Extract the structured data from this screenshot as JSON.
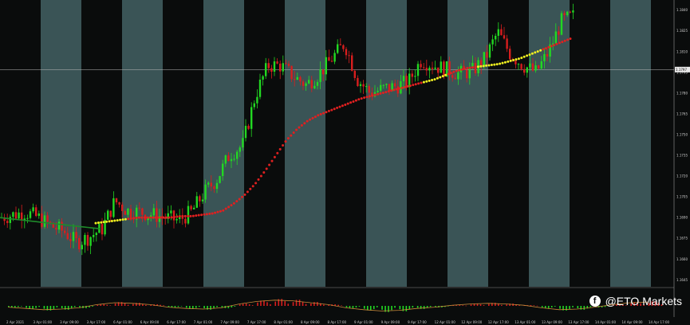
{
  "colors": {
    "background": "#0a0c0c",
    "band": "#3a5456",
    "bull": "#22d822",
    "bear": "#d81e1e",
    "ma_red": "#e02020",
    "ma_yellow": "#f0f020",
    "ma_green": "#1e8a2a",
    "axis_text": "#d0d0d0",
    "watermark": "#ffffff"
  },
  "watermark": {
    "icon": "facebook-icon",
    "text": "@ETO Markets"
  },
  "chart_data": {
    "type": "candlestick",
    "title": "",
    "xlabel": "",
    "ylabel": "",
    "ylim": [
      1.164,
      1.1845
    ],
    "current_price_label": "1.1797",
    "yticks": [
      "1.1840",
      "1.1825",
      "1.1810",
      "1.1795",
      "1.1780",
      "1.1765",
      "1.1750",
      "1.1735",
      "1.1720",
      "1.1705",
      "1.1690",
      "1.1675",
      "1.1660",
      "1.1645"
    ],
    "xticks": [
      "2 Apr 2021",
      "3 Apr 01:00",
      "3 Apr 09:00",
      "3 Apr 17:00",
      "6 Apr 01:00",
      "6 Apr 09:00",
      "6 Apr 17:00",
      "7 Apr 01:00",
      "7 Apr 09:00",
      "7 Apr 17:00",
      "8 Apr 01:00",
      "8 Apr 09:00",
      "8 Apr 17:00",
      "9 Apr 01:00",
      "9 Apr 09:00",
      "9 Apr 17:00",
      "12 Apr 01:00",
      "12 Apr 09:00",
      "12 Apr 17:00",
      "13 Apr 01:00",
      "13 Apr 09:00",
      "13 Apr 17:00",
      "14 Apr 01:00",
      "14 Apr 09:00",
      "14 Apr 17:00"
    ],
    "close_path": [
      1.169,
      1.1692,
      1.1694,
      1.169,
      1.1684,
      1.168,
      1.1672,
      1.1676,
      1.1682,
      1.1702,
      1.1695,
      1.1694,
      1.1692,
      1.169,
      1.1688,
      1.1694,
      1.1708,
      1.1718,
      1.1736,
      1.1742,
      1.1778,
      1.18,
      1.18,
      1.1792,
      1.1786,
      1.1794,
      1.1805,
      1.1816,
      1.179,
      1.178,
      1.1783,
      1.1785,
      1.1788,
      1.1804,
      1.18,
      1.1797,
      1.1794,
      1.1796,
      1.1805,
      1.1824,
      1.1808,
      1.18,
      1.1795,
      1.181,
      1.1832,
      1.1836
    ],
    "ma_slow": [
      1.1686,
      1.1687,
      1.1688,
      1.1689,
      1.169,
      1.169,
      1.169,
      1.169,
      1.1691,
      1.1691,
      1.1692,
      1.1693,
      1.1695,
      1.17,
      1.1706,
      1.1714,
      1.1724,
      1.1735,
      1.1746,
      1.1754,
      1.176,
      1.1764,
      1.1767,
      1.177,
      1.1773,
      1.1776,
      1.1778,
      1.178,
      1.1782,
      1.1784,
      1.1786,
      1.1788,
      1.179,
      1.1793,
      1.1796,
      1.1798,
      1.1799,
      1.18,
      1.1801,
      1.1803,
      1.1805,
      1.1808,
      1.1811,
      1.1814,
      1.1817,
      1.182
    ]
  },
  "indicator": {
    "type": "histogram",
    "values": [
      -0.2,
      -0.4,
      -0.6,
      -0.5,
      -0.3,
      0.2,
      0.5,
      0.4,
      0.2,
      -0.2,
      -0.4,
      -0.5,
      -0.3,
      0.3,
      0.7,
      0.9,
      0.8,
      0.5,
      0.2,
      -0.3,
      -0.6,
      -0.8,
      -0.7,
      -0.4,
      -0.2,
      0.1,
      0.3,
      0.4,
      0.3,
      0.1,
      -0.3,
      -0.6,
      -0.5,
      -0.2,
      0.2,
      0.5,
      0.6
    ]
  }
}
